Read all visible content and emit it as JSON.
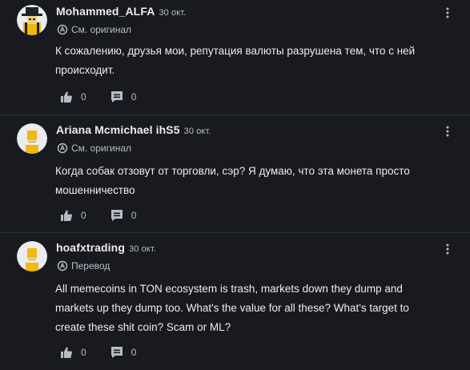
{
  "comments": [
    {
      "user": "Mohammed_ALFA",
      "date": "30 окт.",
      "translation_label": "См. оригинал",
      "text": "К сожалению, друзья мои, репутация валюты разрушена тем, что с ней происходит.",
      "likes": "0",
      "replies": "0",
      "avatar_icon": "hat-avatar-icon"
    },
    {
      "user": "Ariana Mcmichael ihS5",
      "date": "30 окт.",
      "translation_label": "См. оригинал",
      "text": "Когда собак отзовут от торговли, сэр? Я думаю, что эта монета просто мошенничество",
      "likes": "0",
      "replies": "0",
      "avatar_icon": "default-avatar-icon"
    },
    {
      "user": "hoafxtrading",
      "date": "30 окт.",
      "translation_label": "Перевод",
      "text": "All memecoins in TON ecosystem is trash, markets down they dump and markets up they dump too. What's the value for all these? What's target to create these shit coin? Scam or ML?",
      "likes": "0",
      "replies": "0",
      "avatar_icon": "default-avatar-icon"
    }
  ],
  "colors": {
    "background": "#181a20",
    "divider": "#2b3139",
    "text_primary": "#eaecef",
    "text_secondary": "#b7bdc6",
    "avatar_yellow": "#f0b90b"
  }
}
